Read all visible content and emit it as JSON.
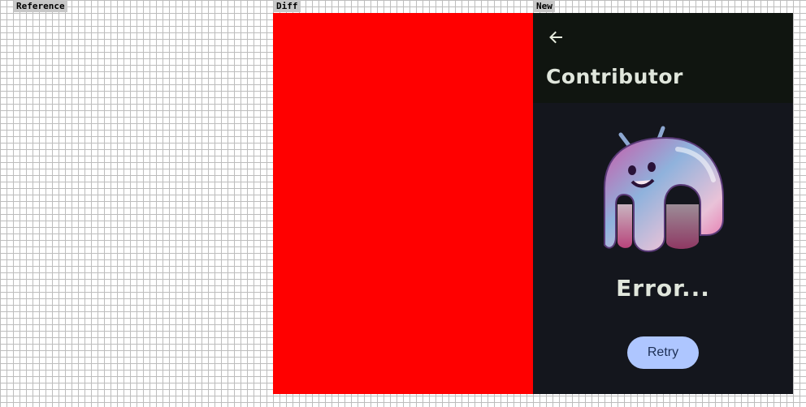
{
  "panels": {
    "reference": "Reference",
    "diff": "Diff",
    "new": "New"
  },
  "app": {
    "title": "Contributor",
    "back_icon": "arrow-back-icon",
    "mascot_icon": "android-mascot-illustration",
    "error_text": "Error...",
    "retry_label": "Retry"
  },
  "colors": {
    "diff": "#ff0000",
    "app_bar": "#101510",
    "background": "#14161d",
    "title_text": "#e0e6dc",
    "retry_button": "#aec6ff"
  }
}
